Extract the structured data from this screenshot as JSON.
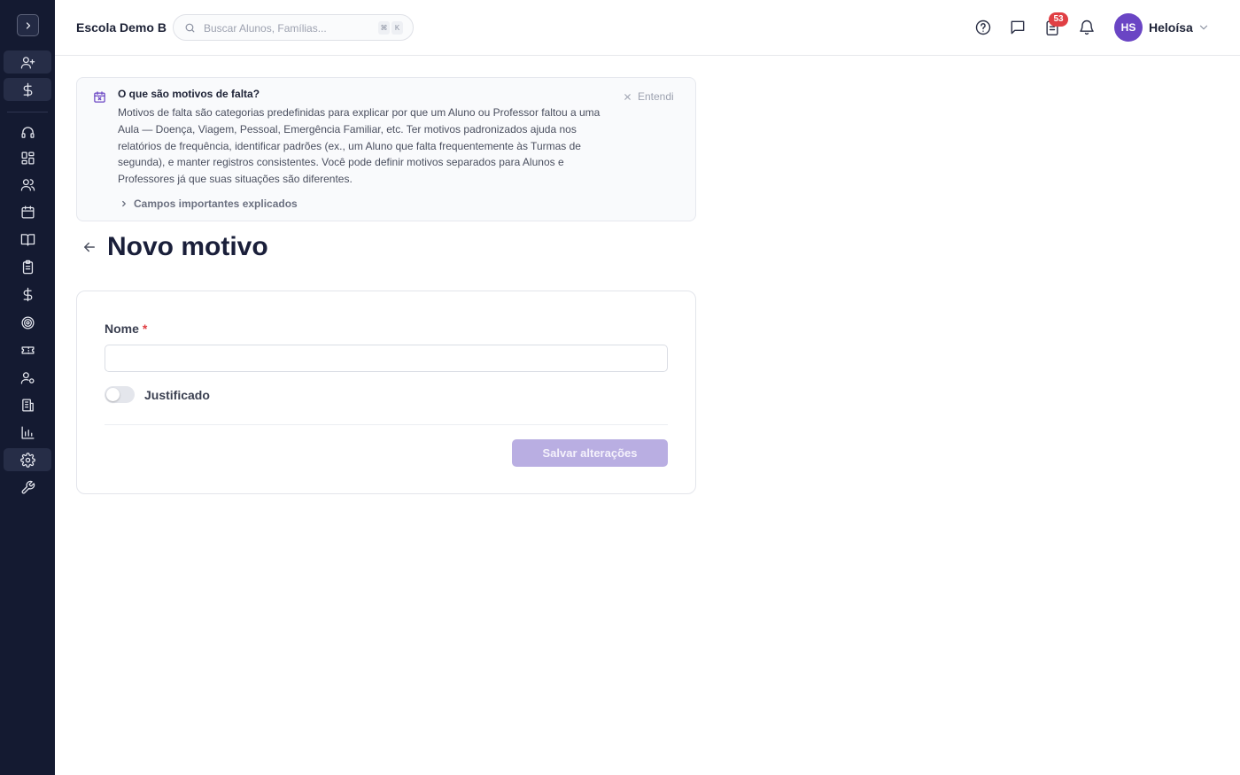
{
  "app": {
    "school_name": "Escola Demo B",
    "search_placeholder": "Buscar Alunos, Famílias...",
    "search_shortcut_keys": [
      "⌘",
      "K"
    ],
    "notifications_count": "53",
    "user": {
      "initials": "HS",
      "name": "Heloísa"
    }
  },
  "sidebar": {
    "items": [
      {
        "icon": "user-plus-icon",
        "highlighted": true
      },
      {
        "icon": "dollar-icon",
        "highlighted": true
      },
      {
        "icon": "headset-icon",
        "highlighted": false
      },
      {
        "icon": "dashboard-icon",
        "highlighted": false
      },
      {
        "icon": "users-icon",
        "highlighted": false
      },
      {
        "icon": "calendar-icon",
        "highlighted": false
      },
      {
        "icon": "book-open-icon",
        "highlighted": false
      },
      {
        "icon": "clipboard-icon",
        "highlighted": false
      },
      {
        "icon": "dollar-icon",
        "highlighted": false
      },
      {
        "icon": "target-icon",
        "highlighted": false
      },
      {
        "icon": "ticket-icon",
        "highlighted": false
      },
      {
        "icon": "user-settings-icon",
        "highlighted": false
      },
      {
        "icon": "building-icon",
        "highlighted": false
      },
      {
        "icon": "bar-chart-icon",
        "highlighted": false
      },
      {
        "icon": "settings-icon",
        "highlighted": true
      },
      {
        "icon": "wrench-icon",
        "highlighted": false
      }
    ]
  },
  "info_box": {
    "title": "O que são motivos de falta?",
    "body": "Motivos de falta são categorias predefinidas para explicar por que um Aluno ou Professor faltou a uma Aula — Doença, Viagem, Pessoal, Emergência Familiar, etc. Ter motivos padronizados ajuda nos relatórios de frequência, identificar padrões (ex., um Aluno que falta frequentemente às Turmas de segunda), e manter registros consistentes. Você pode definir motivos separados para Alunos e Professores já que suas situações são diferentes.",
    "dismiss_label": "Entendi",
    "expand_label": "Campos importantes explicados"
  },
  "page": {
    "title": "Novo motivo"
  },
  "form": {
    "name_label": "Nome",
    "required_mark": "*",
    "name_value": "",
    "justified_label": "Justificado",
    "justified_on": false,
    "save_label": "Salvar alterações"
  },
  "colors": {
    "sidebar_bg": "#141a31",
    "brand_purple": "#6a45c4",
    "save_disabled": "#b9aee2",
    "badge_red": "#e03f44"
  }
}
